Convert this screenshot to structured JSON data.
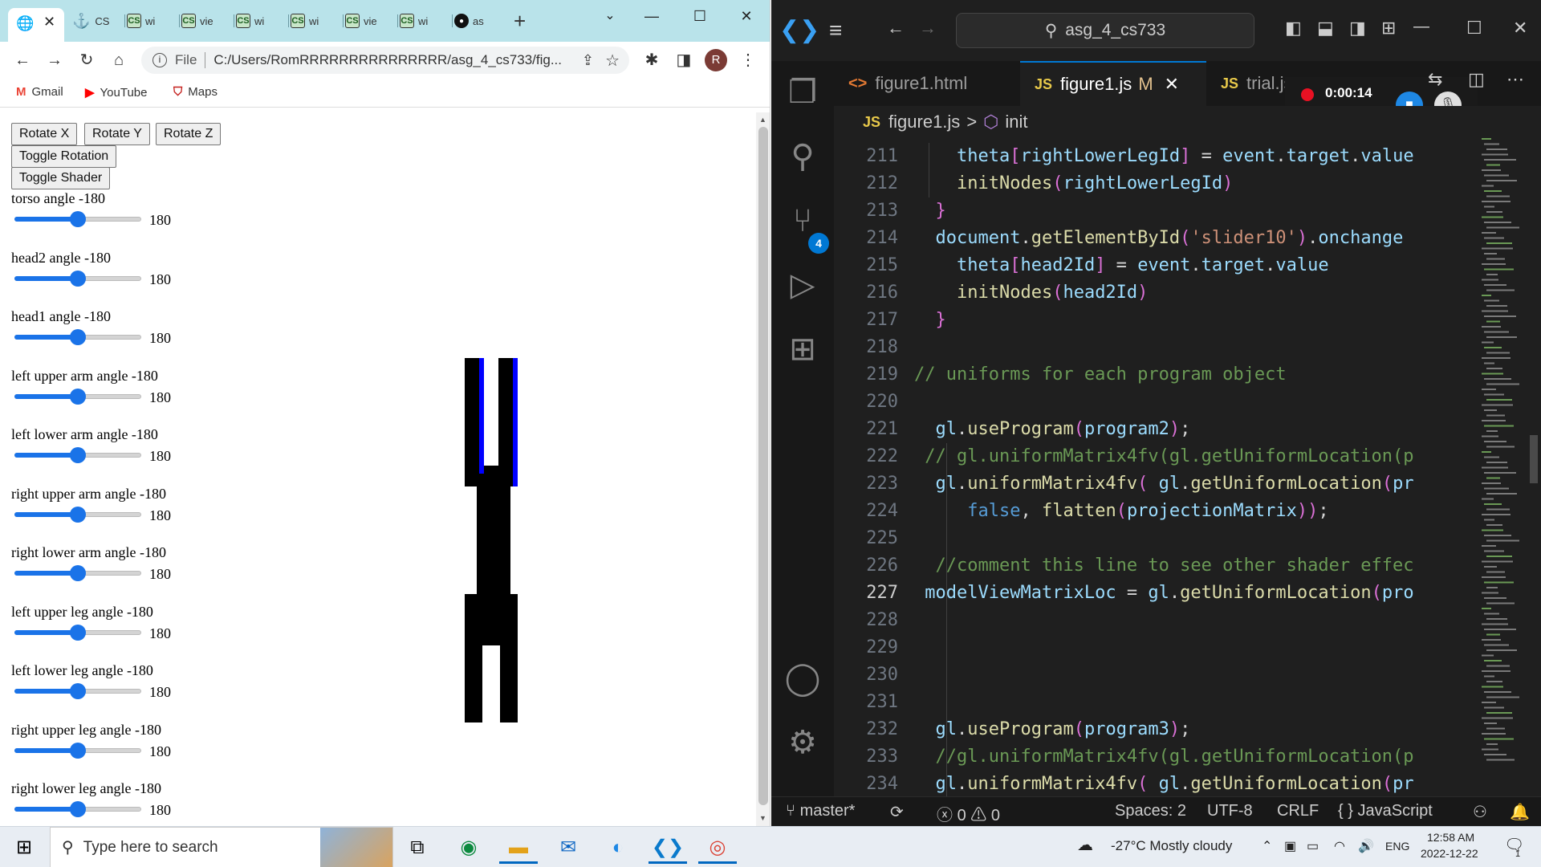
{
  "chrome": {
    "tabs": [
      {
        "label": "CS"
      },
      {
        "label": "wi"
      },
      {
        "label": "vie"
      },
      {
        "label": "wi"
      },
      {
        "label": "wi"
      },
      {
        "label": "vie"
      },
      {
        "label": "wi"
      },
      {
        "label": "as"
      }
    ],
    "new_tab": "+",
    "address": {
      "scheme": "File",
      "url": "C:/Users/RomRRRRRRRRRRRRRRR/asg_4_cs733/fig..."
    },
    "profile_initial": "R",
    "bookmarks": [
      {
        "label": "Gmail",
        "icon": "gmail-icon",
        "color": "#ea4335"
      },
      {
        "label": "YouTube",
        "icon": "youtube-icon",
        "color": "#ff0000"
      },
      {
        "label": "Maps",
        "icon": "maps-icon",
        "color": "#c5221f"
      }
    ]
  },
  "page": {
    "buttons": [
      "Rotate X",
      "Rotate Y",
      "Rotate Z",
      "Toggle Rotation",
      "Toggle Shader"
    ],
    "sliders": [
      {
        "label": "torso angle -180",
        "max": "180",
        "fraction": 0.5
      },
      {
        "label": "head2 angle -180",
        "max": "180",
        "fraction": 0.5
      },
      {
        "label": "head1 angle -180",
        "max": "180",
        "fraction": 0.5
      },
      {
        "label": "left upper arm angle -180",
        "max": "180",
        "fraction": 0.5
      },
      {
        "label": "left lower arm angle -180",
        "max": "180",
        "fraction": 0.5
      },
      {
        "label": "right upper arm angle -180",
        "max": "180",
        "fraction": 0.5
      },
      {
        "label": "right lower arm angle -180",
        "max": "180",
        "fraction": 0.5
      },
      {
        "label": "left upper leg angle -180",
        "max": "180",
        "fraction": 0.5
      },
      {
        "label": "left lower leg angle -180",
        "max": "180",
        "fraction": 0.5
      },
      {
        "label": "right upper leg angle -180",
        "max": "180",
        "fraction": 0.5
      },
      {
        "label": "right lower leg angle -180",
        "max": "180",
        "fraction": 0.5
      }
    ],
    "slider_color": "#1a73e8"
  },
  "vscode": {
    "search": "asg_4_cs733",
    "tabs": [
      {
        "label": "figure1.html",
        "kind": "html"
      },
      {
        "label": "figure1.js",
        "kind": "js",
        "modified": "M",
        "close": "✕"
      },
      {
        "label": "trial.js",
        "kind": "js"
      }
    ],
    "recording_time": "0:00:14",
    "breadcrumb": {
      "file": "figure1.js",
      "sep": ">",
      "symbol": "init"
    },
    "scm_badge": "4",
    "code_lines": [
      {
        "n": "211",
        "html": "    <span class='k'>theta</span><span class='p'>[</span><span class='k'>rightLowerLegId</span><span class='p'>]</span> = <span class='k'>event</span>.<span class='k'>target</span>.<span class='k'>value</span>"
      },
      {
        "n": "212",
        "html": "    <span class='f'>initNodes</span><span class='p'>(</span><span class='k'>rightLowerLegId</span><span class='p'>)</span>"
      },
      {
        "n": "213",
        "html": "  <span class='p'>}</span>"
      },
      {
        "n": "214",
        "html": "  <span class='k'>document</span>.<span class='f'>getElementById</span><span class='p'>(</span><span class='s'>'slider10'</span><span class='p'>)</span>.<span class='k'>onchange</span>"
      },
      {
        "n": "215",
        "html": "    <span class='k'>theta</span><span class='p'>[</span><span class='k'>head2Id</span><span class='p'>]</span> = <span class='k'>event</span>.<span class='k'>target</span>.<span class='k'>value</span>"
      },
      {
        "n": "216",
        "html": "    <span class='f'>initNodes</span><span class='p'>(</span><span class='k'>head2Id</span><span class='p'>)</span>"
      },
      {
        "n": "217",
        "html": "  <span class='p'>}</span>"
      },
      {
        "n": "218",
        "html": ""
      },
      {
        "n": "219",
        "html": "<span class='c'>// uniforms for each program object</span>"
      },
      {
        "n": "220",
        "html": ""
      },
      {
        "n": "221",
        "html": "  <span class='k'>gl</span>.<span class='f'>useProgram</span><span class='p'>(</span><span class='k'>program2</span><span class='p'>)</span>;"
      },
      {
        "n": "222",
        "html": " <span class='c'>// gl.uniformMatrix4fv(gl.getUniformLocation(p</span>"
      },
      {
        "n": "223",
        "html": "  <span class='k'>gl</span>.<span class='f'>uniformMatrix4fv</span><span class='p'>(</span> <span class='k'>gl</span>.<span class='f'>getUniformLocation</span><span class='p'>(</span><span class='k'>pr</span>"
      },
      {
        "n": "224",
        "html": "     <span class='b'>false</span>, <span class='f'>flatten</span><span class='p'>(</span><span class='k'>projectionMatrix</span><span class='p'>))</span>;"
      },
      {
        "n": "225",
        "html": ""
      },
      {
        "n": "226",
        "html": "  <span class='c'>//comment this line to see other shader effec</span>"
      },
      {
        "n": "227",
        "html": " <span class='k'>modelViewMatrixLoc</span> = <span class='k'>gl</span>.<span class='f'>getUniformLocation</span><span class='p'>(</span><span class='k'>pro</span>"
      },
      {
        "n": "228",
        "html": ""
      },
      {
        "n": "229",
        "html": ""
      },
      {
        "n": "230",
        "html": ""
      },
      {
        "n": "231",
        "html": ""
      },
      {
        "n": "232",
        "html": "  <span class='k'>gl</span>.<span class='f'>useProgram</span><span class='p'>(</span><span class='k'>program3</span><span class='p'>)</span>;"
      },
      {
        "n": "233",
        "html": "  <span class='c'>//gl.uniformMatrix4fv(gl.getUniformLocation(p</span>"
      },
      {
        "n": "234",
        "html": "  <span class='k'>gl</span>.<span class='f'>uniformMatrix4fv</span><span class='p'>(</span> <span class='k'>gl</span>.<span class='f'>getUniformLocation</span><span class='p'>(</span><span class='k'>pr</span>"
      }
    ],
    "status": {
      "branch": "master*",
      "errors": "0",
      "warnings": "0",
      "spaces": "Spaces: 2",
      "encoding": "UTF-8",
      "eol": "CRLF",
      "language": "JavaScript"
    }
  },
  "taskbar": {
    "search_placeholder": "Type here to search",
    "weather": "-27°C  Mostly cloudy",
    "lang": "ENG",
    "time": "12:58 AM",
    "date": "2022-12-22",
    "notifications": "1"
  }
}
